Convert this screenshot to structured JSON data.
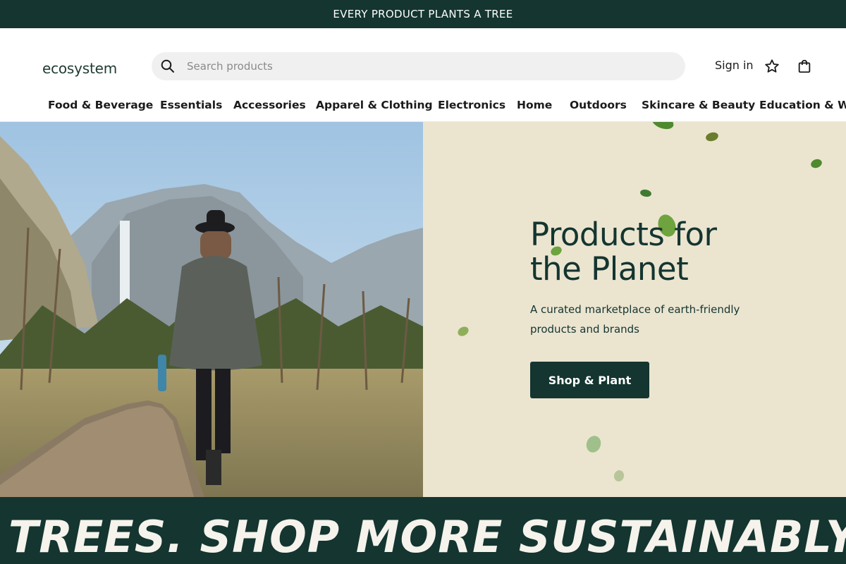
{
  "announcement": {
    "text": "EVERY PRODUCT PLANTS A TREE"
  },
  "header": {
    "logo": "ecosystem",
    "search": {
      "placeholder": "Search products",
      "value": "",
      "icon": "search-icon"
    },
    "signin_label": "Sign in",
    "wishlist_icon": "star-icon",
    "cart_icon": "bag-icon"
  },
  "nav": {
    "items": [
      {
        "label": "Food & Beverage"
      },
      {
        "label": "Essentials"
      },
      {
        "label": "Accessories"
      },
      {
        "label": "Apparel & Clothing"
      },
      {
        "label": "Electronics"
      },
      {
        "label": "Home"
      },
      {
        "label": "Outdoors"
      },
      {
        "label": "Skincare & Beauty"
      },
      {
        "label": "Education & Well"
      }
    ]
  },
  "hero": {
    "title": "Products for the Planet",
    "subtitle": "A curated marketplace of earth-friendly products and brands",
    "cta_label": "Shop & Plant"
  },
  "marquee": {
    "text": "TREES. SHOP MORE SUSTAINABLY. PL"
  },
  "colors": {
    "brand_dark": "#143530",
    "hero_bg": "#ebe5d0",
    "leaf": "#5a8f3a"
  }
}
